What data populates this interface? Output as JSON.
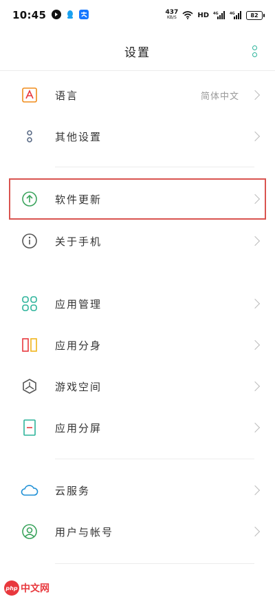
{
  "status_bar": {
    "time": "10:45",
    "net_speed": "437",
    "net_unit": "KB/S",
    "hd_label": "HD",
    "sim1_label": "4G",
    "sim2_label": "4G",
    "battery": "82",
    "left_icons": [
      "tiktok-icon",
      "qq-icon",
      "alipay-icon"
    ],
    "right_icons": [
      "wifi-icon",
      "signal-icon",
      "signal-icon"
    ]
  },
  "header": {
    "title": "设置",
    "more_icon": "more-vertical-icon",
    "accent_color": "#2bb39a"
  },
  "rows": [
    {
      "key": "language",
      "label": "语言",
      "value": "简体中文",
      "icon": "language-icon",
      "icon_color": "#f08c1a"
    },
    {
      "key": "other",
      "label": "其他设置",
      "value": "",
      "icon": "other-settings-icon",
      "icon_color": "#5a6b86"
    },
    {
      "key": "update",
      "label": "软件更新",
      "value": "",
      "icon": "arrow-up-circle-icon",
      "icon_color": "#3aa35c"
    },
    {
      "key": "about",
      "label": "关于手机",
      "value": "",
      "icon": "info-circle-icon",
      "icon_color": "#555555"
    },
    {
      "key": "apps",
      "label": "应用管理",
      "value": "",
      "icon": "apps-grid-icon",
      "icon_color": "#2bb39a"
    },
    {
      "key": "clone",
      "label": "应用分身",
      "value": "",
      "icon": "app-clone-icon",
      "icon_color": "#f08c1a"
    },
    {
      "key": "game",
      "label": "游戏空间",
      "value": "",
      "icon": "game-space-icon",
      "icon_color": "#555555"
    },
    {
      "key": "split",
      "label": "应用分屏",
      "value": "",
      "icon": "split-screen-icon",
      "icon_color": "#2bb39a"
    },
    {
      "key": "cloud",
      "label": "云服务",
      "value": "",
      "icon": "cloud-icon",
      "icon_color": "#1e8fd6"
    },
    {
      "key": "account",
      "label": "用户与帐号",
      "value": "",
      "icon": "user-account-icon",
      "icon_color": "#3aa35c"
    }
  ],
  "highlight_color": "#d9534f",
  "watermark": {
    "badge": "php",
    "text": "中文网"
  }
}
